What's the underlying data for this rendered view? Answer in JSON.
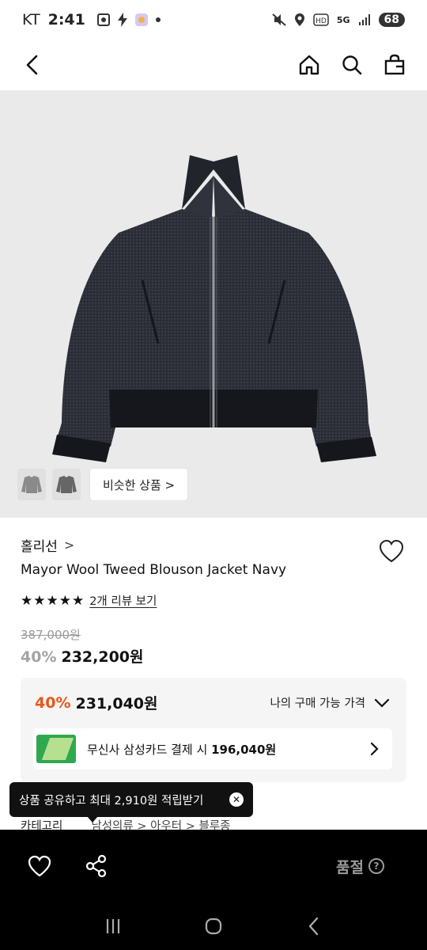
{
  "status_bar": {
    "carrier": "KT",
    "time": "2:41",
    "battery": "68",
    "network": "5G"
  },
  "header": {
    "icons": [
      "back-icon",
      "home-icon",
      "search-icon",
      "cart-icon"
    ]
  },
  "gallery": {
    "similar_label": "비슷한 상품 >"
  },
  "product": {
    "brand": "홀리선",
    "brand_chevron": ">",
    "name": "Mayor Wool Tweed Blouson Jacket Navy",
    "stars": "★★★★★",
    "rating": 5,
    "review_link": "2개 리뷰 보기",
    "original_price": "387,000원",
    "discount": "40%",
    "price": "232,200원"
  },
  "benefit": {
    "discount": "40%",
    "price": "231,040원",
    "label": "나의 구매 가능 가격",
    "card_text_prefix": "무신사 삼성카드 결제 시 ",
    "card_price": "196,040원"
  },
  "tooltip": {
    "text": "상품 공유하고 최대 2,910원 적립받기"
  },
  "category": {
    "label": "카테고리",
    "path": "남성의류 > 아우터 > 블루종"
  },
  "action_bar": {
    "soldout_label": "품절",
    "help_symbol": "?"
  },
  "colors": {
    "accent_orange": "#e8561b",
    "bar_bg": "#000000",
    "jacket": "#2b2d36"
  }
}
